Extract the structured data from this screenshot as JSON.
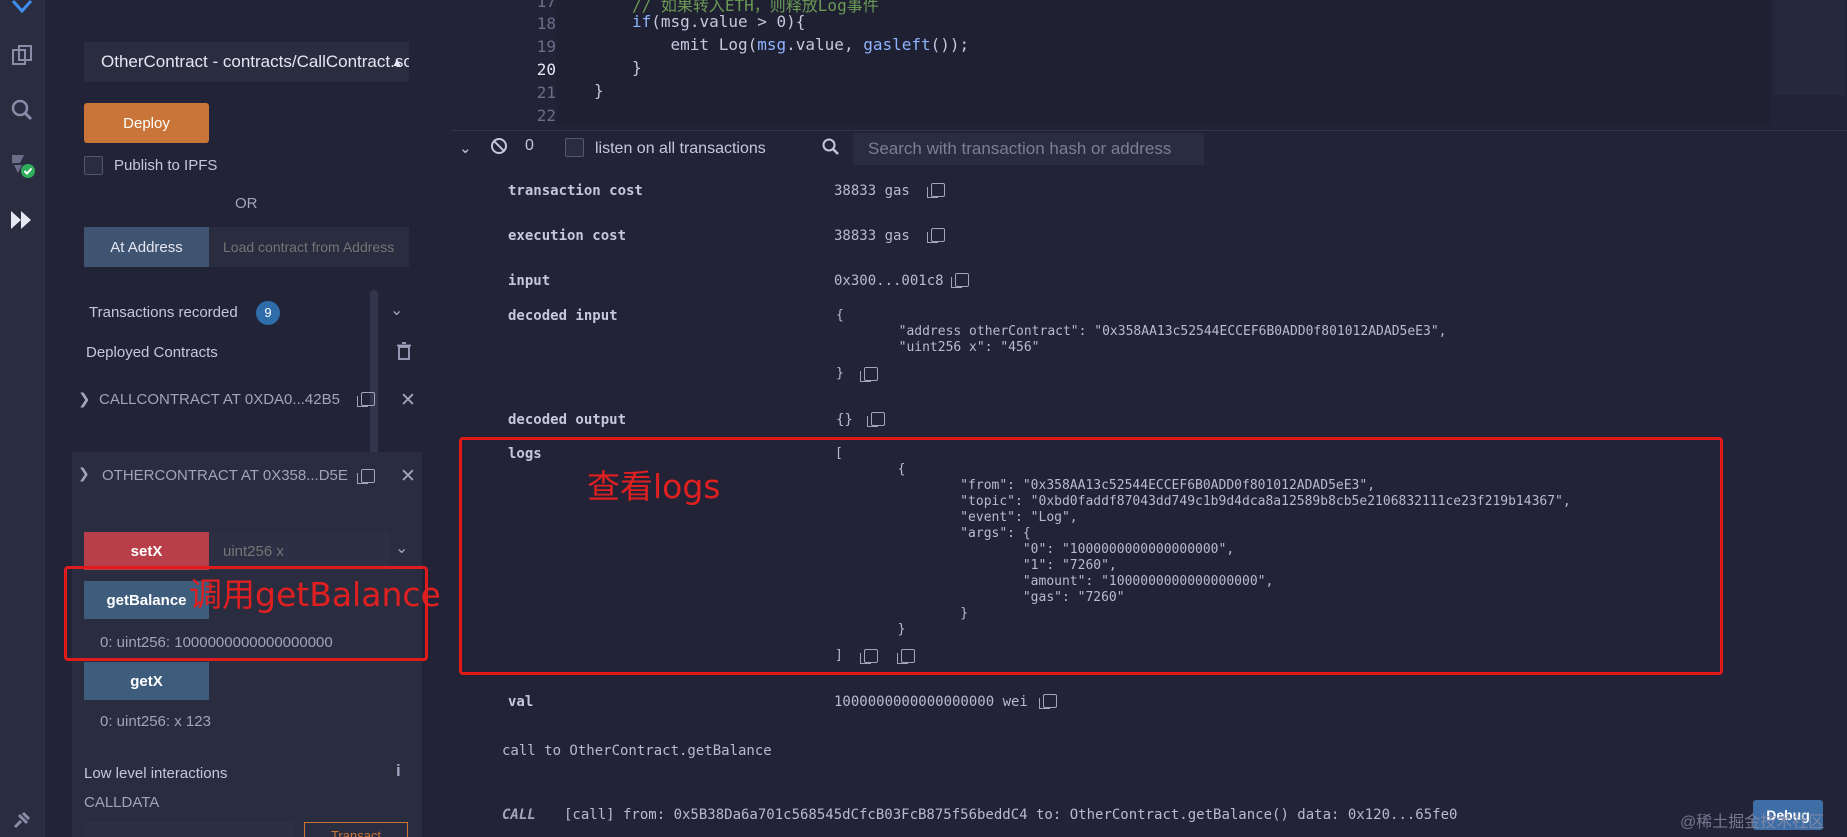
{
  "sidebar": {
    "contract_selected": "OtherContract - contracts/CallContract.sol",
    "deploy_label": "Deploy",
    "publish_ipfs_label": "Publish to IPFS",
    "or_label": "OR",
    "at_address_label": "At Address",
    "load_contract_placeholder": "Load contract from Address",
    "transactions_recorded_label": "Transactions recorded",
    "transactions_recorded_count": "9",
    "deployed_contracts_label": "Deployed Contracts",
    "deployed": [
      {
        "label": "CALLCONTRACT AT 0XDA0...42B5"
      },
      {
        "label": "OTHERCONTRACT AT 0X358...D5E"
      }
    ],
    "functions": {
      "setx_label": "setX",
      "setx_placeholder": "uint256 x",
      "getbalance_label": "getBalance",
      "getbalance_result": "0: uint256: 1000000000000000000",
      "getx_label": "getX",
      "getx_result": "0: uint256: x 123"
    },
    "low_level_label": "Low level interactions",
    "calldata_label": "CALLDATA",
    "transact_label": "Transact"
  },
  "annotations": {
    "getbalance_note": "调用getBalance",
    "logs_note": "查看logs",
    "box_color": "#e11b1b"
  },
  "editor": {
    "lines": [
      {
        "num": "17",
        "code": "// 如果转入ETH，则释放Log事件"
      },
      {
        "num": "18",
        "code": "if(msg.value > 0){"
      },
      {
        "num": "19",
        "code": "    emit Log(msg.value, gasleft());"
      },
      {
        "num": "20",
        "code": "}"
      },
      {
        "num": "21",
        "code": "}"
      },
      {
        "num": "22",
        "code": ""
      }
    ]
  },
  "terminal": {
    "pending_count": "0",
    "listen_label": "listen on all transactions",
    "search_placeholder": "Search with transaction hash or address",
    "rows": {
      "transaction_cost_key": "transaction cost",
      "transaction_cost_val": "38833 gas",
      "execution_cost_key": "execution cost",
      "execution_cost_val": "38833 gas",
      "input_key": "input",
      "input_val": "0x300...001c8",
      "decoded_input_key": "decoded input",
      "decoded_input_lines": [
        "{",
        "        \"address otherContract\": \"0x358AA13c52544ECCEF6B0ADD0f801012ADAD5eE3\",",
        "        \"uint256 x\": \"456\"",
        "}"
      ],
      "decoded_output_key": "decoded output",
      "decoded_output_val": "{}",
      "logs_key": "logs",
      "logs_lines": [
        "[",
        "        {",
        "                \"from\": \"0x358AA13c52544ECCEF6B0ADD0f801012ADAD5eE3\",",
        "                \"topic\": \"0xbd0faddf87043dd749c1b9d4dca8a12589b8cb5e2106832111ce23f219b14367\",",
        "                \"event\": \"Log\",",
        "                \"args\": {",
        "                        \"0\": \"1000000000000000000\",",
        "                        \"1\": \"7260\",",
        "                        \"amount\": \"1000000000000000000\",",
        "                        \"gas\": \"7260\"",
        "                }",
        "        }",
        "]"
      ],
      "val_key": "val",
      "val_val": "1000000000000000000 wei"
    },
    "call_message": "call to OtherContract.getBalance",
    "call_line": {
      "tag": "CALL",
      "text": "[call] from: 0x5B38Da6a701c568545dCfcB03FcB875f56beddC4 to: OtherContract.getBalance() data: 0x120...65fe0"
    },
    "debug_label": "Debug"
  },
  "watermark": "@稀土掘金技术社区",
  "colors": {
    "deploy": "#c97539",
    "setx": "#b83e49",
    "call_btn": "#3e5d7d",
    "annotation": "#e11b1b"
  }
}
